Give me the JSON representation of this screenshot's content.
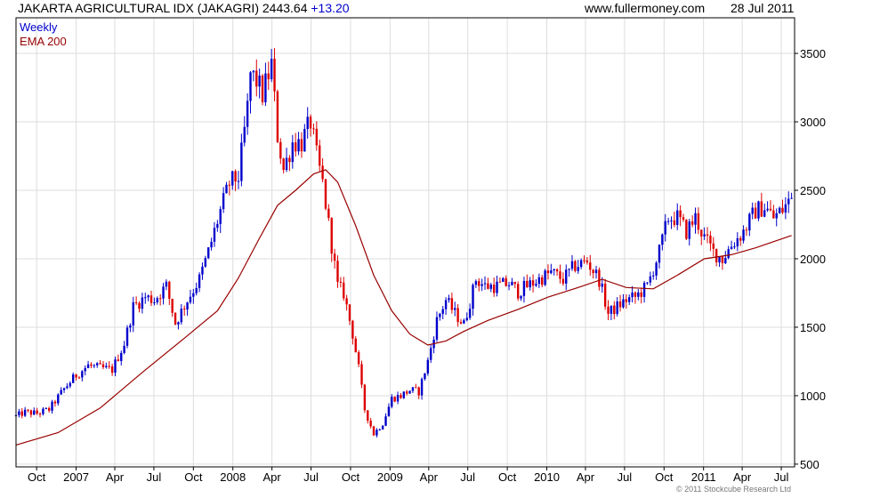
{
  "header": {
    "title": "JAKARTA AGRICULTURAL IDX (JAKAGRI)",
    "last_value": "2443.64",
    "change": "+13.20",
    "website": "www.fullermoney.com",
    "date": "28 Jul 2011"
  },
  "copyright": "© 2011 Stockcube Research Ltd",
  "colors": {
    "up": "#0000cc",
    "down": "#dd0000",
    "ema": "#990000",
    "grid": "#dddddd",
    "weekly_legend": "#0000cc",
    "ema_legend": "#990000"
  },
  "chart_data": {
    "type": "candlestick",
    "legend": [
      "Weekly",
      "EMA 200"
    ],
    "legend_position": "top-left",
    "grid": true,
    "y_axis": {
      "position": "right",
      "ticks": [
        500,
        1000,
        1500,
        2000,
        2500,
        3000,
        3500
      ],
      "ylim": [
        480,
        3760
      ]
    },
    "x_axis": {
      "range": [
        "2006-08-14",
        "2011-08-01"
      ],
      "ticks": [
        {
          "label": "Oct",
          "date": "2006-10-01"
        },
        {
          "label": "2007",
          "date": "2007-01-01"
        },
        {
          "label": "Apr",
          "date": "2007-04-01"
        },
        {
          "label": "Jul",
          "date": "2007-07-01"
        },
        {
          "label": "Oct",
          "date": "2007-10-01"
        },
        {
          "label": "2008",
          "date": "2008-01-01"
        },
        {
          "label": "Apr",
          "date": "2008-04-01"
        },
        {
          "label": "Jul",
          "date": "2008-07-01"
        },
        {
          "label": "Oct",
          "date": "2008-10-01"
        },
        {
          "label": "2009",
          "date": "2009-01-01"
        },
        {
          "label": "Apr",
          "date": "2009-04-01"
        },
        {
          "label": "Jul",
          "date": "2009-07-01"
        },
        {
          "label": "Oct",
          "date": "2009-10-01"
        },
        {
          "label": "2010",
          "date": "2010-01-01"
        },
        {
          "label": "Apr",
          "date": "2010-04-01"
        },
        {
          "label": "Jul",
          "date": "2010-07-01"
        },
        {
          "label": "Oct",
          "date": "2010-10-01"
        },
        {
          "label": "2011",
          "date": "2011-01-01"
        },
        {
          "label": "Apr",
          "date": "2011-04-01"
        },
        {
          "label": "Jul",
          "date": "2011-07-01"
        }
      ]
    },
    "weekly_close": [
      [
        "2006-08-14",
        850
      ],
      [
        "2006-09-04",
        880
      ],
      [
        "2006-10-02",
        870
      ],
      [
        "2006-10-30",
        900
      ],
      [
        "2006-12-04",
        1050
      ],
      [
        "2007-01-01",
        1150
      ],
      [
        "2007-01-29",
        1220
      ],
      [
        "2007-02-26",
        1200
      ],
      [
        "2007-03-26",
        1190
      ],
      [
        "2007-04-23",
        1380
      ],
      [
        "2007-05-14",
        1650
      ],
      [
        "2007-06-11",
        1720
      ],
      [
        "2007-07-02",
        1700
      ],
      [
        "2007-07-30",
        1800
      ],
      [
        "2007-08-20",
        1530
      ],
      [
        "2007-09-17",
        1700
      ],
      [
        "2007-10-15",
        1850
      ],
      [
        "2007-11-05",
        2050
      ],
      [
        "2007-12-03",
        2350
      ],
      [
        "2007-12-24",
        2550
      ],
      [
        "2008-01-14",
        2600
      ],
      [
        "2008-02-04",
        3100
      ],
      [
        "2008-02-11",
        3350
      ],
      [
        "2008-02-25",
        3300
      ],
      [
        "2008-03-10",
        3200
      ],
      [
        "2008-03-31",
        3420
      ],
      [
        "2008-04-14",
        2900
      ],
      [
        "2008-04-28",
        2650
      ],
      [
        "2008-05-19",
        2850
      ],
      [
        "2008-06-09",
        2850
      ],
      [
        "2008-06-30",
        3000
      ],
      [
        "2008-07-14",
        2750
      ],
      [
        "2008-07-28",
        2550
      ],
      [
        "2008-08-11",
        2250
      ],
      [
        "2008-09-01",
        1800
      ],
      [
        "2008-09-15",
        1750
      ],
      [
        "2008-10-06",
        1450
      ],
      [
        "2008-10-20",
        1200
      ],
      [
        "2008-11-03",
        900
      ],
      [
        "2008-11-24",
        720
      ],
      [
        "2008-12-15",
        800
      ],
      [
        "2009-01-05",
        980
      ],
      [
        "2009-01-26",
        1000
      ],
      [
        "2009-02-16",
        1040
      ],
      [
        "2009-03-09",
        1030
      ],
      [
        "2009-03-30",
        1250
      ],
      [
        "2009-04-20",
        1550
      ],
      [
        "2009-05-11",
        1700
      ],
      [
        "2009-06-01",
        1600
      ],
      [
        "2009-06-22",
        1520
      ],
      [
        "2009-07-20",
        1850
      ],
      [
        "2009-08-10",
        1800
      ],
      [
        "2009-09-07",
        1800
      ],
      [
        "2009-10-05",
        1820
      ],
      [
        "2009-10-26",
        1760
      ],
      [
        "2009-11-16",
        1800
      ],
      [
        "2009-12-14",
        1850
      ],
      [
        "2010-01-11",
        1900
      ],
      [
        "2010-02-08",
        1850
      ],
      [
        "2010-03-08",
        1950
      ],
      [
        "2010-04-05",
        1980
      ],
      [
        "2010-05-03",
        1850
      ],
      [
        "2010-05-24",
        1600
      ],
      [
        "2010-06-14",
        1650
      ],
      [
        "2010-07-05",
        1700
      ],
      [
        "2010-07-26",
        1720
      ],
      [
        "2010-08-23",
        1800
      ],
      [
        "2010-09-20",
        2050
      ],
      [
        "2010-10-11",
        2300
      ],
      [
        "2010-11-01",
        2300
      ],
      [
        "2010-11-22",
        2200
      ],
      [
        "2010-12-13",
        2300
      ],
      [
        "2011-01-03",
        2150
      ],
      [
        "2011-01-24",
        2050
      ],
      [
        "2011-02-14",
        2000
      ],
      [
        "2011-03-07",
        2100
      ],
      [
        "2011-04-04",
        2200
      ],
      [
        "2011-05-02",
        2350
      ],
      [
        "2011-05-23",
        2380
      ],
      [
        "2011-06-13",
        2300
      ],
      [
        "2011-07-04",
        2360
      ],
      [
        "2011-07-25",
        2444
      ]
    ],
    "ema_200": [
      [
        "2006-08-14",
        640
      ],
      [
        "2006-11-20",
        730
      ],
      [
        "2007-02-26",
        910
      ],
      [
        "2007-06-04",
        1170
      ],
      [
        "2007-09-10",
        1420
      ],
      [
        "2007-11-26",
        1620
      ],
      [
        "2008-01-14",
        1860
      ],
      [
        "2008-03-03",
        2150
      ],
      [
        "2008-04-14",
        2390
      ],
      [
        "2008-05-26",
        2500
      ],
      [
        "2008-07-07",
        2620
      ],
      [
        "2008-08-04",
        2650
      ],
      [
        "2008-09-01",
        2560
      ],
      [
        "2008-10-13",
        2240
      ],
      [
        "2008-11-24",
        1880
      ],
      [
        "2009-01-05",
        1620
      ],
      [
        "2009-02-16",
        1450
      ],
      [
        "2009-03-30",
        1370
      ],
      [
        "2009-05-11",
        1400
      ],
      [
        "2009-06-22",
        1470
      ],
      [
        "2009-08-17",
        1550
      ],
      [
        "2009-10-26",
        1630
      ],
      [
        "2010-01-04",
        1720
      ],
      [
        "2010-03-15",
        1790
      ],
      [
        "2010-05-10",
        1850
      ],
      [
        "2010-07-05",
        1790
      ],
      [
        "2010-09-06",
        1780
      ],
      [
        "2010-11-01",
        1880
      ],
      [
        "2011-01-03",
        2000
      ],
      [
        "2011-03-07",
        2030
      ],
      [
        "2011-05-02",
        2080
      ],
      [
        "2011-07-25",
        2170
      ]
    ]
  }
}
